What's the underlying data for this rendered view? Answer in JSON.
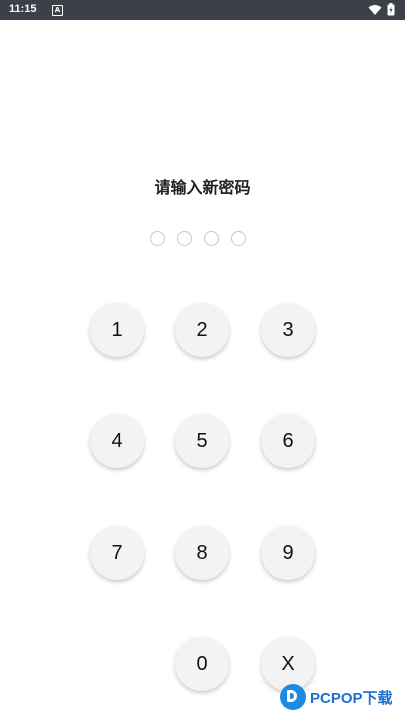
{
  "status_bar": {
    "time": "11:15",
    "notification_icon": "A",
    "wifi_icon": "wifi-icon",
    "battery_icon": "battery-icon"
  },
  "title": "请输入新密码",
  "pin_dots_count": 4,
  "keypad": {
    "k1": "1",
    "k2": "2",
    "k3": "3",
    "k4": "4",
    "k5": "5",
    "k6": "6",
    "k7": "7",
    "k8": "8",
    "k9": "9",
    "k0": "0",
    "kdel": "X"
  },
  "watermark": {
    "text": "PCPOP下载",
    "color": "#1d6fd0"
  }
}
